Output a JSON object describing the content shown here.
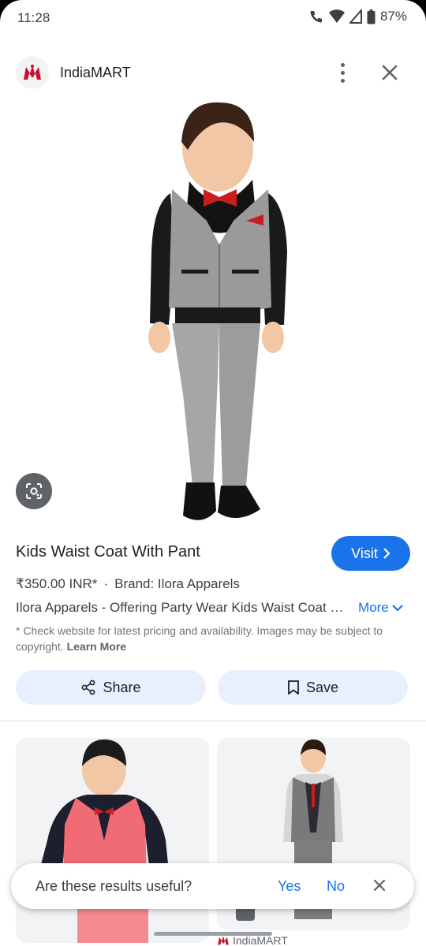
{
  "status_bar": {
    "time": "11:28",
    "battery": "87%"
  },
  "header": {
    "source_name": "IndiaMART"
  },
  "product": {
    "title": "Kids Waist Coat With Pant",
    "visit_label": "Visit",
    "price": "₹350.00 INR*",
    "brand": "Brand: Ilora Apparels",
    "description": "Ilora Apparels - Offering Party Wear Kids Waist Coat With Pant",
    "more_label": "More",
    "disclaimer": "* Check website for latest pricing and availability. Images may be subject to copyright.",
    "learn_more": "Learn More"
  },
  "actions": {
    "share_label": "Share",
    "save_label": "Save"
  },
  "related": {
    "source_label": "IndiaMART"
  },
  "feedback": {
    "question": "Are these results useful?",
    "yes": "Yes",
    "no": "No"
  },
  "colors": {
    "accent": "#1a73e8",
    "pill_bg": "#e8f0fe",
    "logo_red": "#c8102e"
  },
  "icons": [
    "signal-icon",
    "wifi-icon",
    "battery-icon",
    "indiamart-logo",
    "more-vert-icon",
    "close-icon",
    "lens-icon",
    "chevron-right-icon",
    "chevron-down-icon",
    "share-icon",
    "bookmark-icon"
  ]
}
